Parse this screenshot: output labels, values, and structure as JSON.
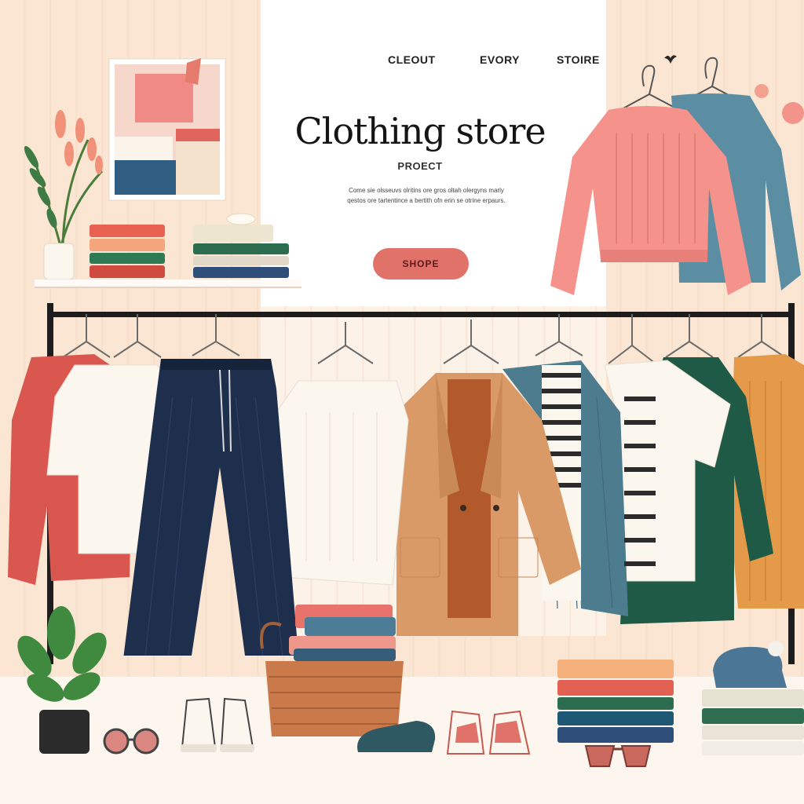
{
  "nav": {
    "items": [
      {
        "label": "CLEOUT"
      },
      {
        "label": "EVORY"
      },
      {
        "label": "STOIRE"
      }
    ]
  },
  "hero": {
    "title": "Clothing store",
    "subtitle": "PROECT",
    "description_line1": "Come sie olsseuvs olritins ore gros oltah olergyns marly",
    "description_line2": "qestos ore tartentince a bertith ofn erin se otrine erpaurs.",
    "cta_label": "SHOPE"
  },
  "colors": {
    "accent": "#e0726a",
    "coral": "#d9574f",
    "sweater_pink": "#f48c86",
    "teal": "#4e7c8f",
    "navy": "#1e2f4d",
    "camel": "#d99a68",
    "green": "#1f5a47",
    "orange": "#e49a48",
    "cream": "#fbf7ef"
  },
  "icons": [
    "hanger-icon",
    "bird-icon",
    "plant-icon",
    "sunglasses-icon",
    "sneaker-icon",
    "basket-icon"
  ]
}
